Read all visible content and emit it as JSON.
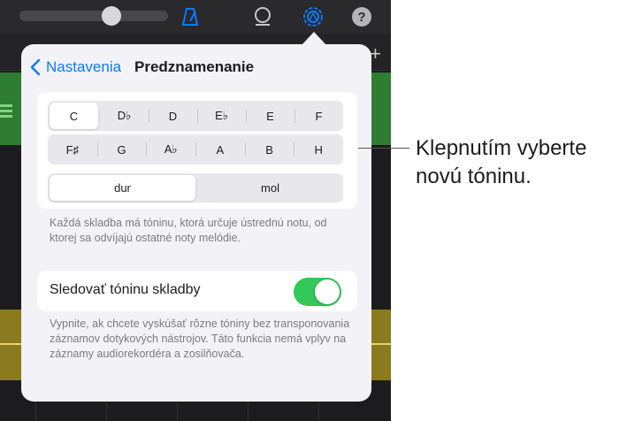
{
  "toolbar": {
    "volume_level": 0.62,
    "icons": [
      "metronome-icon",
      "loop-icon",
      "settings-icon",
      "help-icon"
    ],
    "help_label": "?",
    "add_track_label": "+"
  },
  "colors": {
    "accent": "#0a7aff",
    "toggle_on": "#34c759",
    "popover_bg": "#f2f2f7",
    "track_green": "#2e7d32",
    "track_yellow": "#8a7a1e"
  },
  "popover": {
    "back_label": "Nastavenia",
    "title": "Predznamenanie",
    "notes_row_1": [
      "C",
      "D♭",
      "D",
      "E♭",
      "E",
      "F"
    ],
    "notes_row_2": [
      "F♯",
      "G",
      "A♭",
      "A",
      "B",
      "H"
    ],
    "selected_note": "C",
    "modes": [
      "dur",
      "mol"
    ],
    "selected_mode": "dur",
    "key_description": "Každá skladba má tóninu, ktorá určuje ústrednú notu, od ktorej sa odvíjajú ostatné noty melódie.",
    "follow_label": "Sledovať tóninu skladby",
    "follow_on": true,
    "follow_description": "Vypnite, ak chcete vyskúšať rôzne tóniny bez transponovania záznamov dotykových nástrojov. Táto funkcia nemá vplyv na záznamy audiorekordéra a zosilňovača."
  },
  "callout": {
    "text": "Klepnutím vyberte novú tóninu."
  }
}
